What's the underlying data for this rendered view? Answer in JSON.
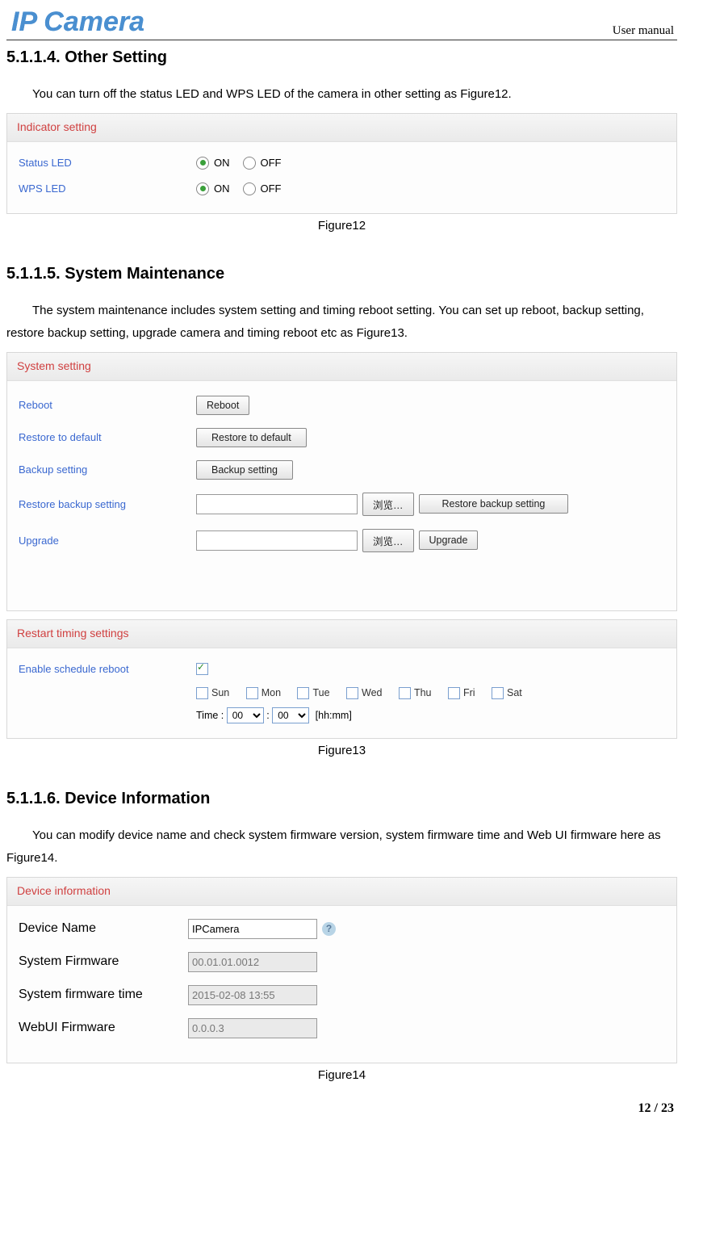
{
  "header": {
    "logo": "IP Camera",
    "right": "User manual"
  },
  "s1": {
    "heading": "5.1.1.4. Other Setting",
    "para": "You can turn off the status LED and WPS LED of the camera in other setting as Figure12.",
    "panel_title": "Indicator setting",
    "row1_label": "Status LED",
    "row2_label": "WPS LED",
    "on": "ON",
    "off": "OFF",
    "caption": "Figure12"
  },
  "s2": {
    "heading": "5.1.1.5. System Maintenance",
    "para": "The system maintenance includes system setting and timing reboot setting. You can set up reboot, backup setting, restore backup setting, upgrade camera and timing reboot etc as Figure13.",
    "panel1_title": "System setting",
    "r_reboot": "Reboot",
    "b_reboot": "Reboot",
    "r_restore": "Restore to default",
    "b_restore": "Restore to default",
    "r_backup": "Backup setting",
    "b_backup": "Backup setting",
    "r_restorebk": "Restore backup setting",
    "b_browse": "浏览…",
    "b_restorebk": "Restore backup setting",
    "r_upgrade": "Upgrade",
    "b_upgrade": "Upgrade",
    "panel2_title": "Restart timing settings",
    "enable_label": "Enable schedule reboot",
    "days": [
      "Sun",
      "Mon",
      "Tue",
      "Wed",
      "Thu",
      "Fri",
      "Sat"
    ],
    "time_label": "Time :",
    "hh": "00",
    "mm": "00",
    "hint": "[hh:mm]",
    "caption": "Figure13"
  },
  "s3": {
    "heading": "5.1.1.6. Device Information",
    "para": "You can modify device name and check system firmware version, system firmware time and Web UI firmware here as Figure14.",
    "panel_title": "Device information",
    "l_devname": "Device Name",
    "v_devname": "IPCamera",
    "l_sysfw": "System Firmware",
    "v_sysfw": "00.01.01.0012",
    "l_sysfwtime": "System firmware time",
    "v_sysfwtime": "2015-02-08 13:55",
    "l_webui": "WebUI Firmware",
    "v_webui": "0.0.0.3",
    "caption": "Figure14"
  },
  "footer": {
    "page": "12 / 23"
  }
}
